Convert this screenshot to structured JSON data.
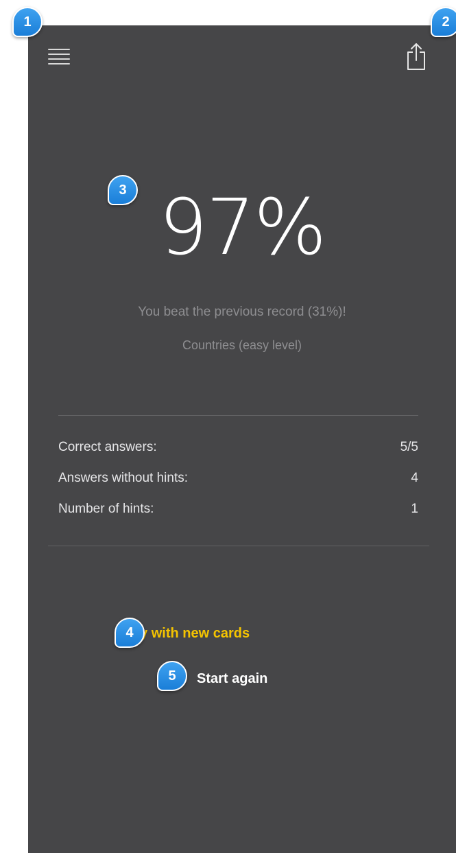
{
  "header": {
    "menu_icon": "hamburger-menu-icon",
    "share_icon": "share-icon"
  },
  "result": {
    "percent": "97%",
    "record_message": "You beat the previous record (31%)!",
    "category": "Countries (easy level)"
  },
  "stats": [
    {
      "label": "Correct answers:",
      "value": "5/5"
    },
    {
      "label": "Answers without hints:",
      "value": "4"
    },
    {
      "label": "Number of hints:",
      "value": "1"
    }
  ],
  "actions": {
    "play_new_label": "Play with new cards",
    "start_again_label": "Start again"
  },
  "annotations": [
    "1",
    "2",
    "3",
    "4",
    "5"
  ],
  "colors": {
    "background": "#464648",
    "accent": "#f5c400",
    "badge": "#1a7ed8"
  }
}
